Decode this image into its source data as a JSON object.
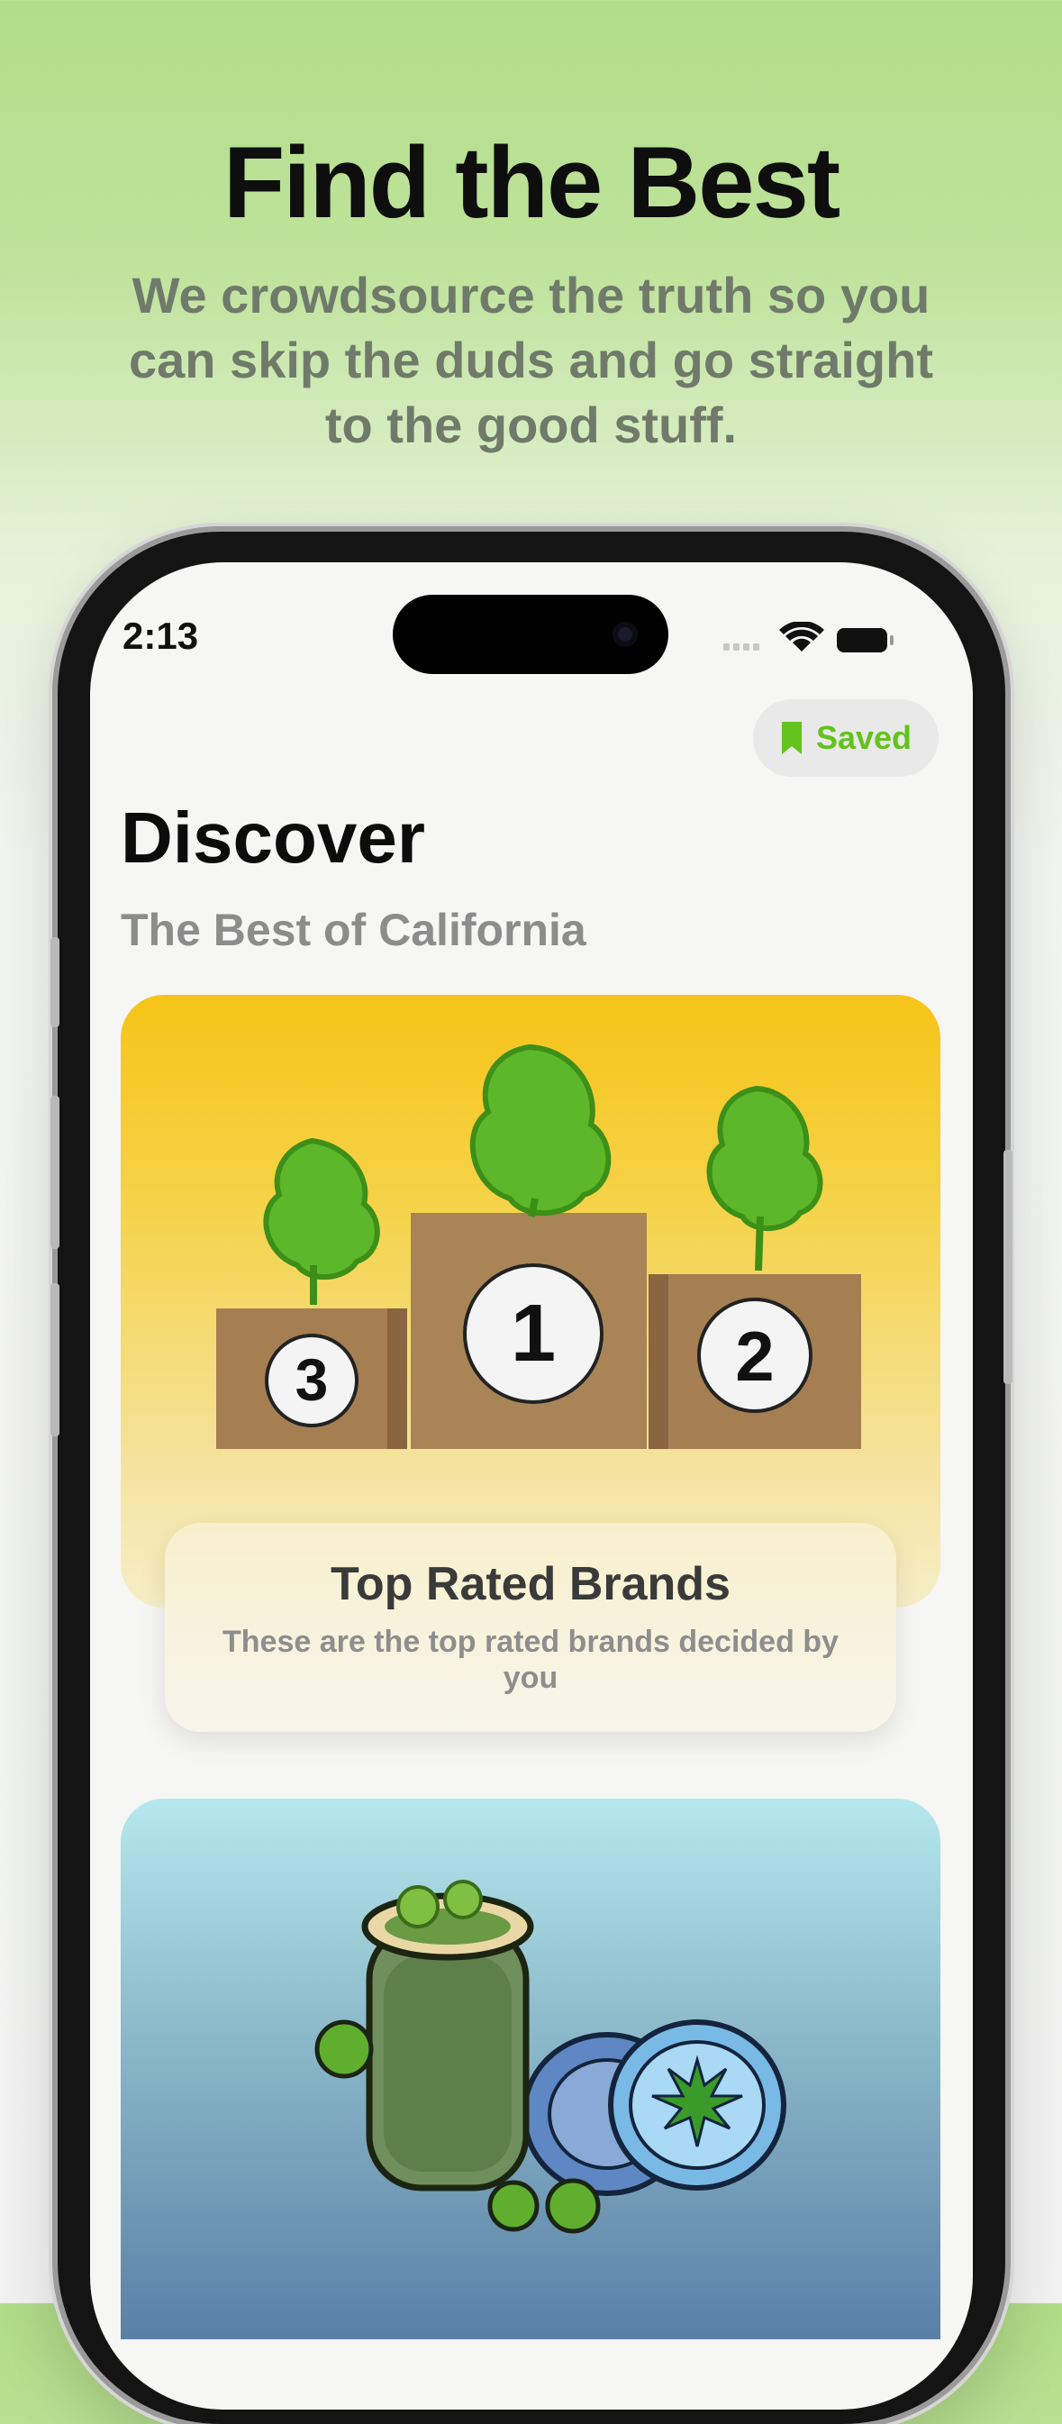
{
  "hero": {
    "title": "Find the Best",
    "subtitle": "We crowdsource the truth so you can skip the duds and go straight to the good stuff."
  },
  "status_bar": {
    "time": "2:13",
    "icons": [
      "cellular-icon",
      "wifi-icon",
      "battery-icon"
    ]
  },
  "saved_button": {
    "label": "Saved",
    "icon": "bookmark-icon",
    "color": "#64c21c"
  },
  "page": {
    "title": "Discover",
    "subtitle": "The Best of California"
  },
  "cards": [
    {
      "illustration": "podium-illustration",
      "podium_ranks": [
        "3",
        "1",
        "2"
      ],
      "title": "Top Rated Brands",
      "description": "These are the top rated brands decided by you"
    },
    {
      "illustration": "jar-and-grinder-illustration"
    }
  ]
}
